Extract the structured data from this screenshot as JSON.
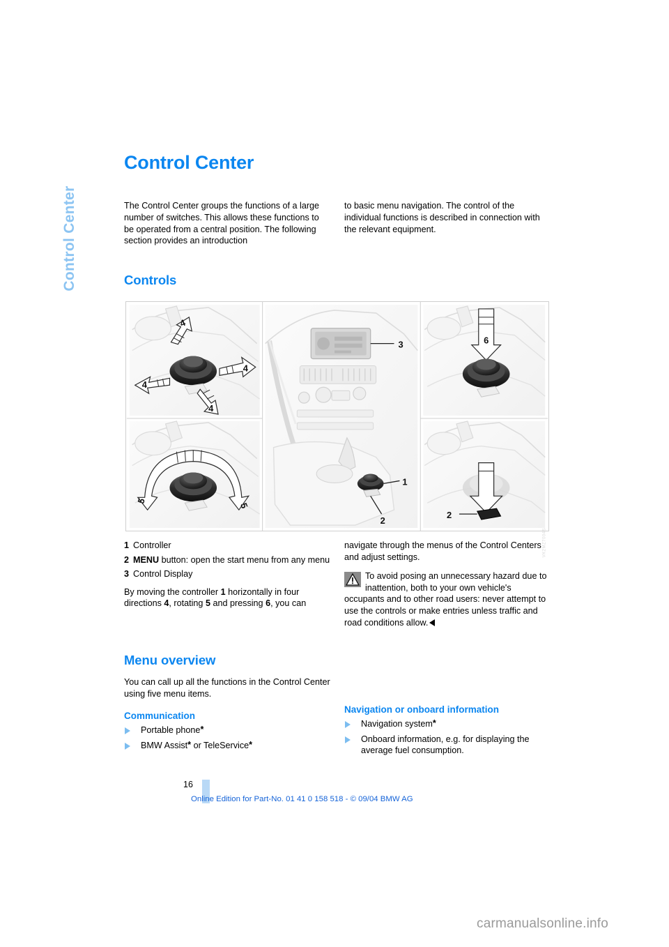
{
  "document": {
    "chapter_tab": "Control Center",
    "page_title": "Control Center",
    "watermark": "carmanualsonline.info",
    "accent_blue": "#0b86f0",
    "tab_blue": "#8cc4f2",
    "footer_blue": "#1463d8"
  },
  "intro": {
    "left": "The Control Center groups the functions of a large number of switches. This allows these functions to be operated from a central position. The following section provides an introduction",
    "right": "to basic menu navigation. The control of the individual functions is described in connection with the relevant equipment."
  },
  "controls": {
    "heading": "Controls",
    "figure": {
      "callouts": [
        "1",
        "2",
        "3",
        "4",
        "5",
        "6"
      ],
      "panels": [
        {
          "name": "controller-four-directions",
          "label": "4"
        },
        {
          "name": "dashboard-control-display",
          "label": "3"
        },
        {
          "name": "controller-press",
          "label": "6"
        },
        {
          "name": "controller-rotate",
          "label": "5"
        },
        {
          "name": "menu-button-press",
          "label": "2"
        },
        {
          "name": "center-console-controller",
          "label": "1"
        }
      ],
      "figure_code": "VK2MZ7004S"
    },
    "legend": [
      {
        "num": "1",
        "bold": "",
        "text": "Controller"
      },
      {
        "num": "2",
        "bold": "MENU",
        "text": " button: open the start menu from any menu"
      },
      {
        "num": "3",
        "bold": "",
        "text": "Control Display"
      }
    ],
    "paragraph_left_1": "By moving the controller ",
    "paragraph_left_b1": "1",
    "paragraph_left_2": " horizontally in four directions ",
    "paragraph_left_b2": "4",
    "paragraph_left_3": ", rotating ",
    "paragraph_left_b3": "5",
    "paragraph_left_4": " and pressing ",
    "paragraph_left_b4": "6",
    "paragraph_left_5": ", you can",
    "paragraph_right": "navigate through the menus of the Control Centers and adjust settings.",
    "warning": "To avoid posing an unnecessary hazard due to inattention, both to your own vehicle's occupants and to other road users: never attempt to use the controls or make entries unless traffic and road conditions allow."
  },
  "menu_overview": {
    "heading": "Menu overview",
    "intro": "You can call up all the functions in the Control Center using five menu items.",
    "sections": [
      {
        "title": "Communication",
        "items": [
          {
            "text": "Portable phone",
            "star": "*"
          },
          {
            "text": "BMW Assist",
            "star": "*",
            "text2": " or TeleService",
            "star2": "*"
          }
        ]
      },
      {
        "title": "Navigation or onboard information",
        "items": [
          {
            "text": "Navigation system",
            "star": "*"
          },
          {
            "text": "Onboard information, e.g. for displaying the average fuel consumption.",
            "star": ""
          }
        ]
      }
    ]
  },
  "footer": {
    "page_number": "16",
    "edition_text": "Online Edition for Part-No. 01 41 0 158 518 - © 09/04 BMW AG"
  }
}
